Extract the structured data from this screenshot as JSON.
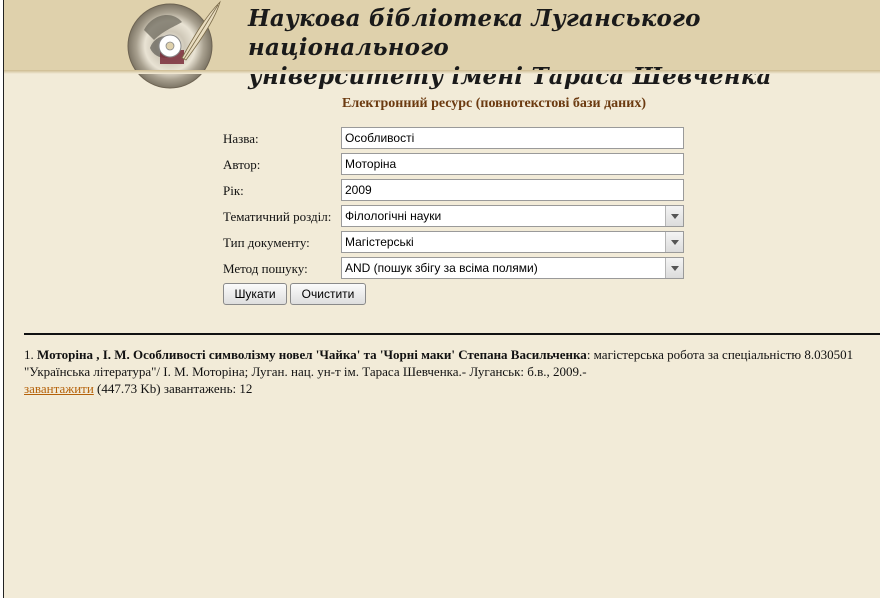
{
  "header": {
    "title_line1": "Наукова бібліотека Луганського національного",
    "title_line2": "університету імені Тараса Шевченка"
  },
  "section_title": "Електронний ресурс (повнотекстові бази даних)",
  "form": {
    "title": {
      "label": "Назва:",
      "value": "Особливості"
    },
    "author": {
      "label": "Автор:",
      "value": "Моторіна"
    },
    "year": {
      "label": "Рік:",
      "value": "2009"
    },
    "subject": {
      "label": "Тематичний розділ:",
      "value": "Філологічні науки"
    },
    "doc_type": {
      "label": "Тип документу:",
      "value": "Магістерські"
    },
    "search_method": {
      "label": "Метод пошуку:",
      "value": "AND (пошук збігу за всіма полями)"
    }
  },
  "buttons": {
    "search": "Шукати",
    "clear": "Очистити"
  },
  "results": [
    {
      "number": "1.",
      "bold_text": "Моторіна , І. М. Особливості символізму новел 'Чайка' та 'Чорні маки' Степана Васильченка",
      "rest_text": ": магістерська робота за спеціальністю 8.030501 \"Українська література\"/ І. М. Моторіна; Луган. нац. ун-т ім. Тараса Шевченка.- Луганськ: б.в., 2009.-",
      "download_link": "завантажити",
      "size": "(447.73 Kb)",
      "downloads": "завантажень: 12"
    }
  ],
  "colors": {
    "page_bg": "#f2ebd8",
    "header_bg": "#dfd1ac",
    "section_title": "#6b3a10",
    "link": "#b5620a"
  },
  "icons": {
    "logo": "cd-with-feather-quill-logo",
    "select_arrow": "chevron-down-icon"
  }
}
